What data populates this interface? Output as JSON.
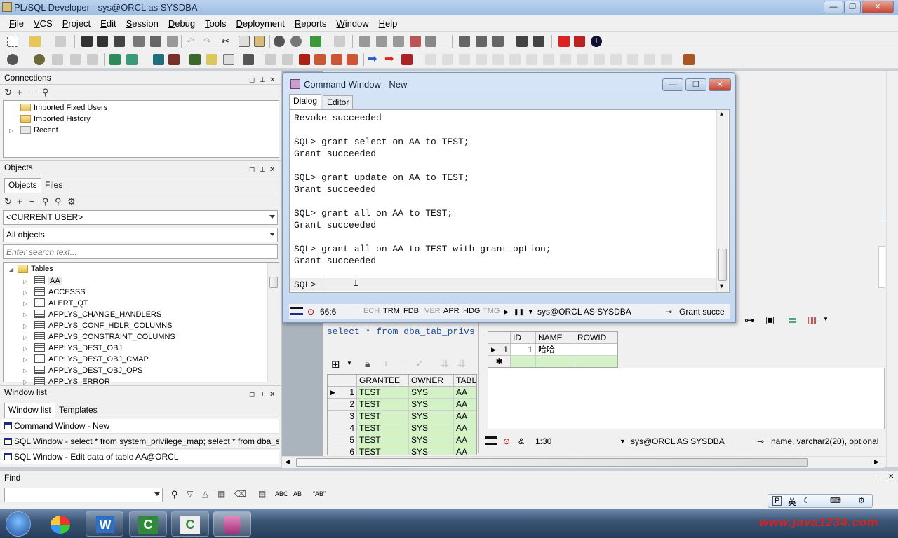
{
  "app": {
    "title": "PL/SQL Developer - sys@ORCL as SYSDBA"
  },
  "menu": [
    "File",
    "VCS",
    "Project",
    "Edit",
    "Session",
    "Debug",
    "Tools",
    "Deployment",
    "Reports",
    "Window",
    "Help"
  ],
  "connections": {
    "title": "Connections",
    "items": [
      "Imported Fixed Users",
      "Imported History",
      "Recent"
    ]
  },
  "objects": {
    "title": "Objects",
    "tabs": [
      "Objects",
      "Files"
    ],
    "user_select": "<CURRENT USER>",
    "filter_select": "All objects",
    "search_placeholder": "Enter search text...",
    "root": "Tables",
    "tables": [
      "AA",
      "ACCESSS",
      "ALERT_QT",
      "APPLYS_CHANGE_HANDLERS",
      "APPLYS_CONF_HDLR_COLUMNS",
      "APPLYS_CONSTRAINT_COLUMNS",
      "APPLYS_DEST_OBJ",
      "APPLYS_DEST_OBJ_CMAP",
      "APPLYS_DEST_OBJ_OPS",
      "APPLYS_ERROR"
    ]
  },
  "window_list": {
    "title": "Window list",
    "tabs": [
      "Window list",
      "Templates"
    ],
    "items": [
      "Command Window - New",
      "SQL Window - select * from system_privilege_map; select * from dba_sy",
      "SQL Window - Edit data of table AA@ORCL"
    ]
  },
  "command_window": {
    "title": "Command Window - New",
    "tabs": [
      "Dialog",
      "Editor"
    ],
    "lines": [
      "Revoke succeeded",
      "",
      "SQL> grant select on AA to TEST;",
      "Grant succeeded",
      "",
      "SQL> grant update on AA to TEST;",
      "Grant succeeded",
      "",
      "SQL> grant all on AA to TEST;",
      "Grant succeeded",
      "",
      "SQL> grant all on AA to TEST with grant option;",
      "Grant succeeded",
      "",
      "SQL> "
    ],
    "status": {
      "position": "66:6",
      "flags": [
        "ECH",
        "TRM",
        "FDB",
        "VER",
        "APR",
        "HDG",
        "TMG"
      ],
      "connection": "sys@ORCL AS SYSDBA",
      "message": "Grant succe"
    }
  },
  "sql_window": {
    "query": "select * from dba_tab_privs",
    "columns": [
      "GRANTEE",
      "OWNER",
      "TABL"
    ],
    "rows": [
      {
        "n": "1",
        "grantee": "TEST",
        "owner": "SYS",
        "table": "AA"
      },
      {
        "n": "2",
        "grantee": "TEST",
        "owner": "SYS",
        "table": "AA"
      },
      {
        "n": "3",
        "grantee": "TEST",
        "owner": "SYS",
        "table": "AA"
      },
      {
        "n": "4",
        "grantee": "TEST",
        "owner": "SYS",
        "table": "AA"
      },
      {
        "n": "5",
        "grantee": "TEST",
        "owner": "SYS",
        "table": "AA"
      },
      {
        "n": "6",
        "grantee": "TEST",
        "owner": "SYS",
        "table": "AA"
      }
    ]
  },
  "edit_window": {
    "columns": [
      "ID",
      "NAME",
      "ROWID"
    ],
    "row": {
      "n": "1",
      "id": "1",
      "name": "哈哈"
    },
    "status": {
      "position": "1:30",
      "connection": "sys@ORCL AS SYSDBA",
      "message": "name, varchar2(20), optional"
    }
  },
  "find": {
    "title": "Find",
    "tools": [
      "ABC",
      "AB"
    ]
  },
  "ime": {
    "lang": "英"
  },
  "watermark": "www.java1234.com"
}
